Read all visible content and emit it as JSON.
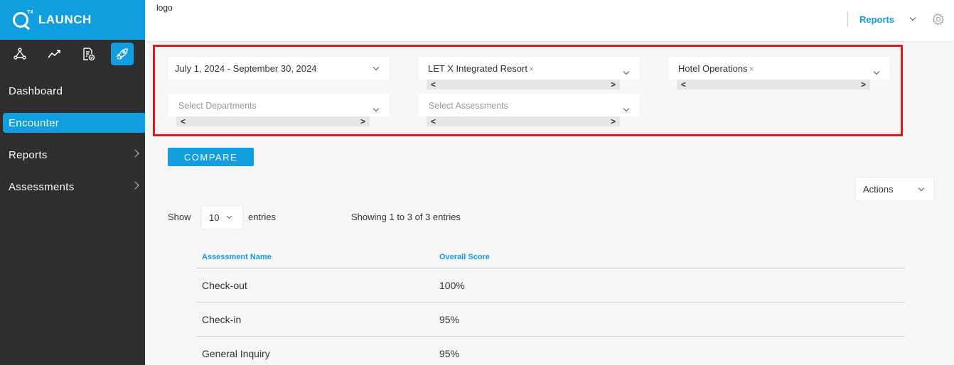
{
  "brand": {
    "name": "LAUNCH",
    "superscript": "TX"
  },
  "sidebar": {
    "icons": [
      "org-icon",
      "trend-icon",
      "report-check-icon",
      "rocket-icon"
    ],
    "items": [
      {
        "label": "Dashboard"
      },
      {
        "label": "Encounter"
      },
      {
        "label": "Reports"
      },
      {
        "label": "Assessments"
      }
    ]
  },
  "header": {
    "logo": "logo",
    "reports": "Reports"
  },
  "filters": {
    "date_range": "July 1, 2024 - September 30, 2024",
    "property": "LET X Integrated Resort",
    "division": "Hotel Operations",
    "departments_placeholder": "Select Departments",
    "assessments_placeholder": "Select Assessments",
    "remove_glyph": "×",
    "scroll_left": "<",
    "scroll_right": ">"
  },
  "compare_label": "COMPARE",
  "actions_label": "Actions",
  "table_controls": {
    "show": "Show",
    "entries_value": "10",
    "entries": "entries",
    "info": "Showing 1 to 3 of 3 entries"
  },
  "table": {
    "headers": [
      "Assessment Name",
      "Overall Score"
    ],
    "rows": [
      [
        "Check-out",
        "100%"
      ],
      [
        "Check-in",
        "95%"
      ],
      [
        "General Inquiry",
        "95%"
      ]
    ]
  },
  "colors": {
    "accent": "#119ee0",
    "sidebar": "#2e2e2e",
    "highlight": "#e3141b"
  }
}
